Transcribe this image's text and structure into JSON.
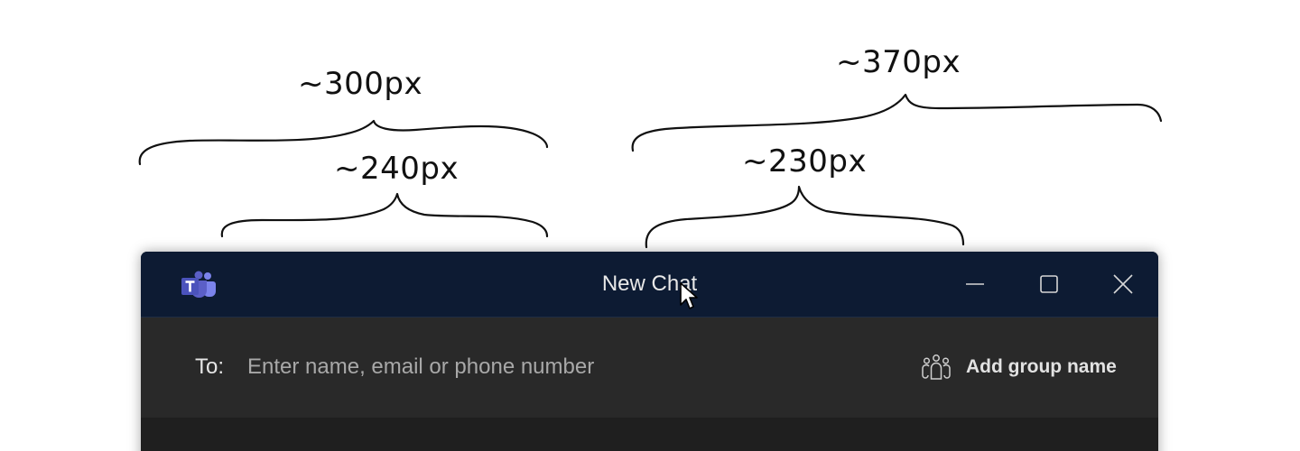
{
  "annotations": {
    "labels": [
      "~300px",
      "~240px",
      "~370px",
      "~230px"
    ]
  },
  "window": {
    "title": "New Chat",
    "app_icon": "teams-logo-icon",
    "controls": {
      "minimize_icon": "minimize-icon",
      "maximize_icon": "maximize-icon",
      "close_icon": "close-icon"
    }
  },
  "compose": {
    "to_label": "To:",
    "input_placeholder": "Enter name, email or phone number",
    "input_value": "",
    "group_icon": "people-group-icon",
    "add_group_label": "Add group name"
  },
  "colors": {
    "titlebar": "#0d1b33",
    "panel": "#292929",
    "body": "#1f1f1f",
    "teams_brand": "#5b5fc7"
  }
}
